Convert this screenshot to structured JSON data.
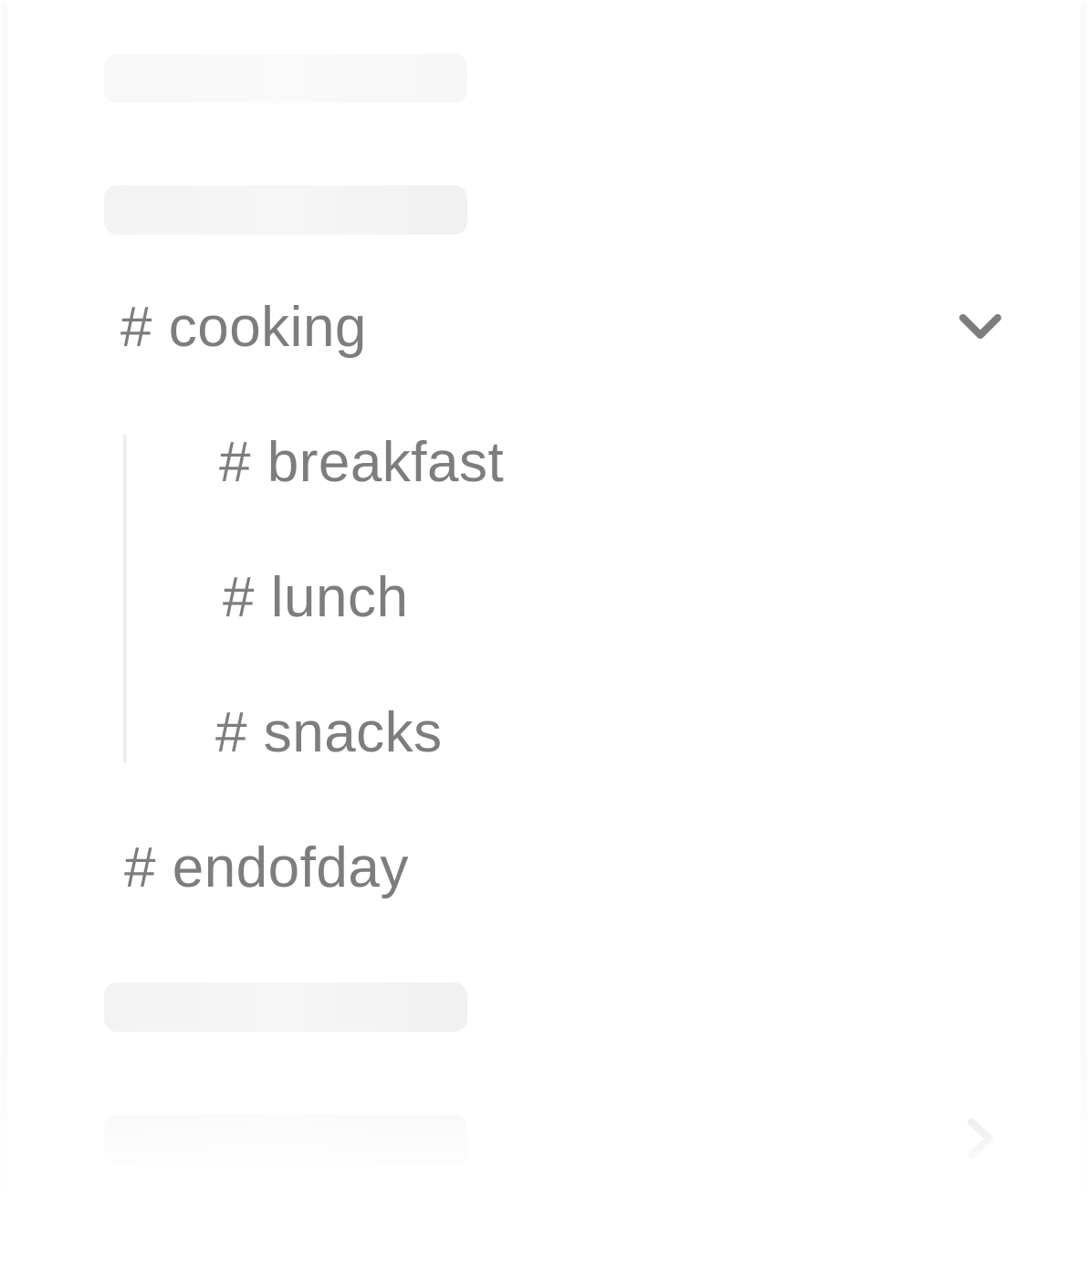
{
  "channels": {
    "parent": {
      "label": "# cooking",
      "expanded": true
    },
    "children": [
      {
        "label": "# breakfast"
      },
      {
        "label": "# lunch"
      },
      {
        "label": "# snacks"
      }
    ],
    "sibling": {
      "label": "# endofday"
    }
  },
  "icons": {
    "expand": "chevron-down-icon",
    "collapsed": "chevron-right-icon"
  },
  "colors": {
    "text": "#7d7d7d",
    "chevron": "#7d7d7d",
    "placeholder": "#f3f3f3",
    "guide": "#eeeeee"
  }
}
